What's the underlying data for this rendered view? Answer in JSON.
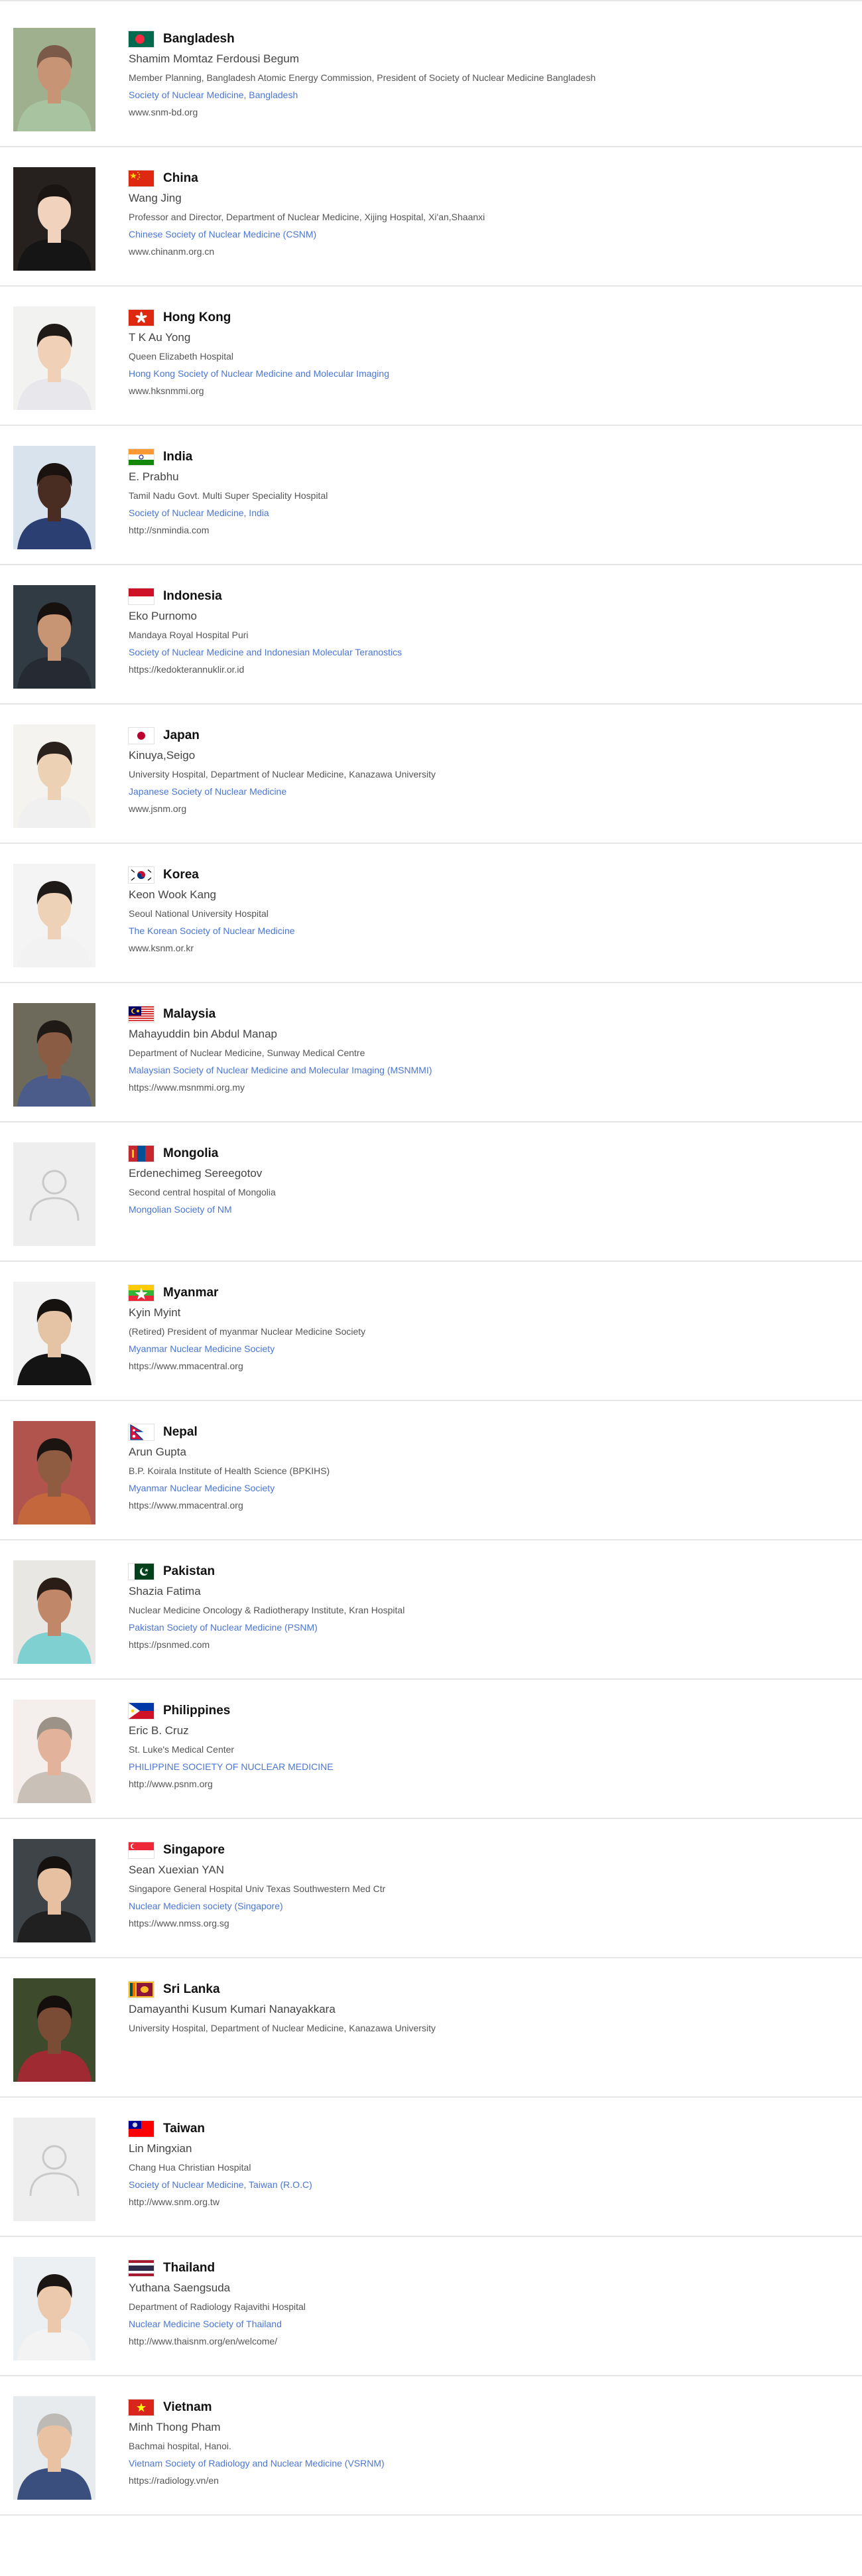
{
  "colors": {
    "link": "#4a76d6",
    "divider": "#e6e6e6",
    "text": "#444444"
  },
  "members": [
    {
      "country": "Bangladesh",
      "flag": "bangladesh-flag",
      "name": "Shamim Momtaz Ferdousi Begum",
      "affiliation": "Member Planning, Bangladesh Atomic Energy Commission, President of Society of Nuclear Medicine Bangladesh",
      "society": "Society of Nuclear Medicine, Bangladesh",
      "website": "www.snm-bd.org",
      "photo": "person-portrait"
    },
    {
      "country": "China",
      "flag": "china-flag",
      "name": "Wang Jing",
      "affiliation": "Professor and Director, Department of Nuclear Medicine, Xijing Hospital, Xi'an,Shaanxi",
      "society": "Chinese Society of Nuclear Medicine (CSNM)",
      "website": "www.chinanm.org.cn",
      "photo": "person-portrait"
    },
    {
      "country": "Hong Kong",
      "flag": "hong-kong-flag",
      "name": "T K Au Yong",
      "affiliation": "Queen Elizabeth Hospital",
      "society": "Hong Kong Society of Nuclear Medicine and Molecular Imaging",
      "website": "www.hksnmmi.org",
      "photo": "person-portrait"
    },
    {
      "country": "India",
      "flag": "india-flag",
      "name": "E. Prabhu",
      "affiliation": "Tamil Nadu Govt. Multi Super Speciality Hospital",
      "society": "Society of Nuclear Medicine, India",
      "website": "http://snmindia.com",
      "photo": "person-portrait"
    },
    {
      "country": "Indonesia",
      "flag": "indonesia-flag",
      "name": "Eko Purnomo",
      "affiliation": "Mandaya Royal Hospital Puri",
      "society": "Society of Nuclear Medicine and Indonesian Molecular Teranostics",
      "website": "https://kedokterannuklir.or.id",
      "photo": "person-portrait"
    },
    {
      "country": "Japan",
      "flag": "japan-flag",
      "name": "Kinuya,Seigo",
      "affiliation": "University Hospital, Department of Nuclear Medicine, Kanazawa University",
      "society": "Japanese Society of Nuclear Medicine",
      "website": "www.jsnm.org",
      "photo": "person-portrait"
    },
    {
      "country": "Korea",
      "flag": "korea-flag",
      "name": "Keon Wook Kang",
      "affiliation": "Seoul National University Hospital",
      "society": "The Korean Society of Nuclear Medicine",
      "website": "www.ksnm.or.kr",
      "photo": "person-portrait"
    },
    {
      "country": "Malaysia",
      "flag": "malaysia-flag",
      "name": "Mahayuddin bin Abdul Manap",
      "affiliation": "Department of Nuclear Medicine, Sunway Medical Centre",
      "society": "Malaysian Society of Nuclear Medicine and Molecular Imaging (MSNMMI)",
      "website": "https://www.msnmmi.org.my",
      "photo": "person-portrait"
    },
    {
      "country": "Mongolia",
      "flag": "mongolia-flag",
      "name": "Erdenechimeg Sereegotov",
      "affiliation": "Second central hospital of Mongolia",
      "society": "Mongolian Society of NM",
      "website": "",
      "photo": "avatar-placeholder"
    },
    {
      "country": "Myanmar",
      "flag": "myanmar-flag",
      "name": "Kyin Myint",
      "affiliation": "(Retired) President of myanmar Nuclear Medicine Society",
      "society": "Myanmar Nuclear Medicine Society",
      "website": "https://www.mmacentral.org",
      "photo": "person-portrait"
    },
    {
      "country": "Nepal",
      "flag": "nepal-flag",
      "name": "Arun Gupta",
      "affiliation": "B.P. Koirala Institute of Health Science (BPKIHS)",
      "society": "Myanmar Nuclear Medicine Society",
      "website": "https://www.mmacentral.org",
      "photo": "person-portrait"
    },
    {
      "country": "Pakistan",
      "flag": "pakistan-flag",
      "name": "Shazia Fatima",
      "affiliation": "Nuclear Medicine Oncology & Radiotherapy Institute, Kran Hospital",
      "society": "Pakistan Society of Nuclear Medicine (PSNM)",
      "website": "https://psnmed.com",
      "photo": "person-portrait"
    },
    {
      "country": "Philippines",
      "flag": "philippines-flag",
      "name": "Eric B. Cruz",
      "affiliation": "St. Luke's Medical Center",
      "society": "PHILIPPINE SOCIETY OF NUCLEAR MEDICINE",
      "website": "http://www.psnm.org",
      "photo": "person-portrait"
    },
    {
      "country": "Singapore",
      "flag": "singapore-flag",
      "name": "Sean Xuexian YAN",
      "affiliation": "Singapore General Hospital Univ Texas Southwestern Med Ctr",
      "society": "Nuclear Medicien society (Singapore)",
      "website": "https://www.nmss.org.sg",
      "photo": "person-portrait"
    },
    {
      "country": "Sri Lanka",
      "flag": "sri-lanka-flag",
      "name": "Damayanthi Kusum Kumari Nanayakkara",
      "affiliation": "University Hospital, Department of Nuclear Medicine, Kanazawa University",
      "society": "",
      "website": "",
      "photo": "person-portrait"
    },
    {
      "country": "Taiwan",
      "flag": "taiwan-flag",
      "name": "Lin Mingxian",
      "affiliation": "Chang Hua Christian Hospital",
      "society": "Society of Nuclear Medicine, Taiwan (R.O.C)",
      "website": "http://www.snm.org.tw",
      "photo": "avatar-placeholder"
    },
    {
      "country": "Thailand",
      "flag": "thailand-flag",
      "name": "Yuthana Saengsuda",
      "affiliation": "Department of Radiology Rajavithi Hospital",
      "society": "Nuclear Medicine Society of Thailand",
      "website": "http://www.thaisnm.org/en/welcome/",
      "photo": "person-portrait"
    },
    {
      "country": "Vietnam",
      "flag": "vietnam-flag",
      "name": "Minh Thong Pham",
      "affiliation": "Bachmai hospital, Hanoi.",
      "society": "Vietnam Society of Radiology and Nuclear Medicine (VSRNM)",
      "website": "https://radiology.vn/en",
      "photo": "person-portrait"
    }
  ]
}
